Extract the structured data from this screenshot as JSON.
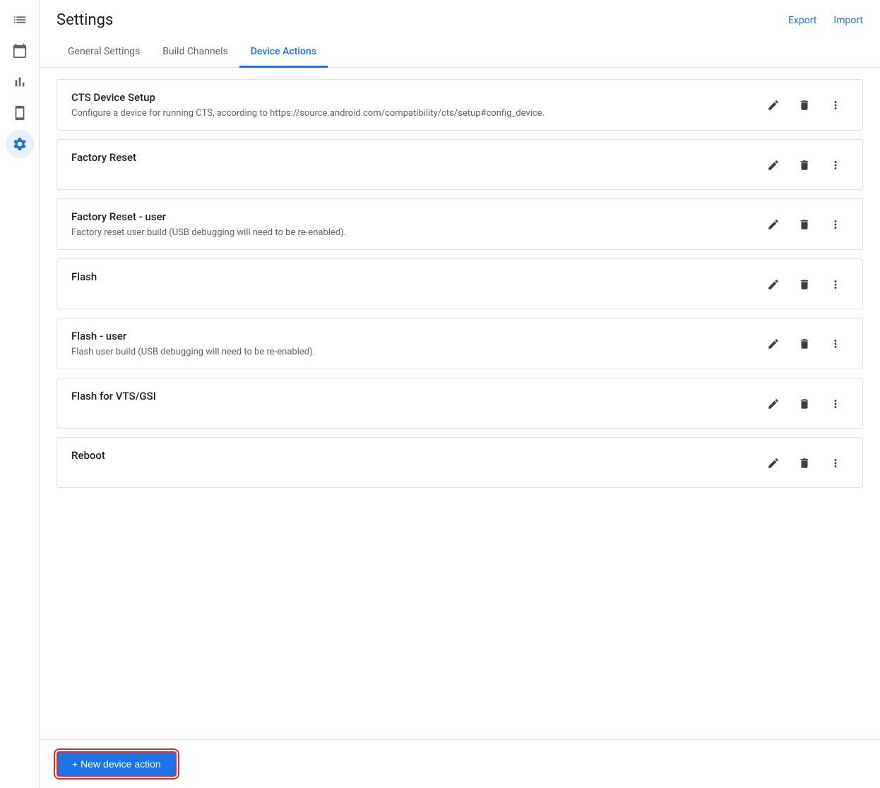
{
  "app": {
    "title": "Settings"
  },
  "header": {
    "title": "Settings",
    "export_label": "Export",
    "import_label": "Import"
  },
  "tabs": [
    {
      "id": "general",
      "label": "General Settings",
      "active": false
    },
    {
      "id": "build-channels",
      "label": "Build Channels",
      "active": false
    },
    {
      "id": "device-actions",
      "label": "Device Actions",
      "active": true
    }
  ],
  "sidebar": {
    "items": [
      {
        "id": "list",
        "icon": "list-icon",
        "active": false
      },
      {
        "id": "calendar",
        "icon": "calendar-icon",
        "active": false
      },
      {
        "id": "chart",
        "icon": "chart-icon",
        "active": false
      },
      {
        "id": "phone",
        "icon": "phone-icon",
        "active": false
      },
      {
        "id": "settings",
        "icon": "settings-icon",
        "active": true
      }
    ]
  },
  "device_actions": [
    {
      "id": "cts-device-setup",
      "title": "CTS Device Setup",
      "description": "Configure a device for running CTS, according to https://source.android.com/compatibility/cts/setup#config_device."
    },
    {
      "id": "factory-reset",
      "title": "Factory Reset",
      "description": ""
    },
    {
      "id": "factory-reset-user",
      "title": "Factory Reset - user",
      "description": "Factory reset user build (USB debugging will need to be re-enabled)."
    },
    {
      "id": "flash",
      "title": "Flash",
      "description": ""
    },
    {
      "id": "flash-user",
      "title": "Flash - user",
      "description": "Flash user build (USB debugging will need to be re-enabled)."
    },
    {
      "id": "flash-vts-gsi",
      "title": "Flash for VTS/GSI",
      "description": ""
    },
    {
      "id": "reboot",
      "title": "Reboot",
      "description": ""
    }
  ],
  "footer": {
    "new_action_label": "+ New device action"
  }
}
